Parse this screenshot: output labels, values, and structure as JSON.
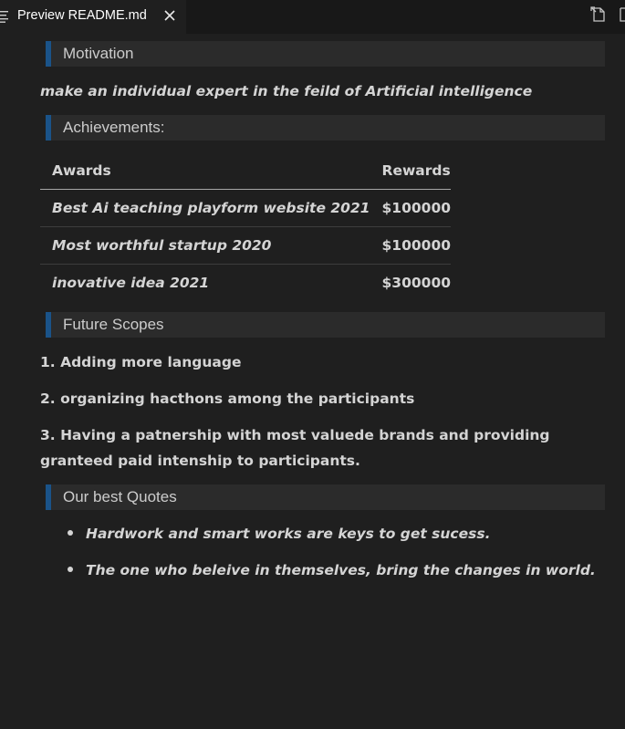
{
  "tab": {
    "title": "Preview README.md",
    "preview_icon": "preview-lines-icon",
    "close_icon": "close-icon"
  },
  "toolbar": {
    "open_source_icon": "open-source-icon",
    "more_icon": "split-editor-icon"
  },
  "colors": {
    "background": "#1f1f1f",
    "heading_background": "#2b2b2b",
    "heading_accent": "#1a5389",
    "text": "#d4d4d4"
  },
  "sections": {
    "motivation": {
      "heading": "Motivation",
      "text": "make an individual expert in the feild of Artificial intelligence"
    },
    "achievements": {
      "heading": "Achievements:",
      "columns": [
        "Awards",
        "Rewards"
      ],
      "rows": [
        {
          "award": "Best Ai teaching playform website 2021",
          "reward": "$100000"
        },
        {
          "award": "Most worthful startup 2020",
          "reward": "$100000"
        },
        {
          "award": "inovative idea 2021",
          "reward": "$300000"
        }
      ]
    },
    "future_scopes": {
      "heading": "Future Scopes",
      "items": [
        "1. Adding more language",
        "2. organizing hacthons among the participants",
        "3. Having a patnership with most valuede brands and providing granteed paid intenship to participants."
      ]
    },
    "quotes": {
      "heading": "Our best Quotes",
      "items": [
        "Hardwork and smart works are keys to get sucess.",
        "The one who beleive in themselves, bring the changes in world."
      ]
    }
  }
}
